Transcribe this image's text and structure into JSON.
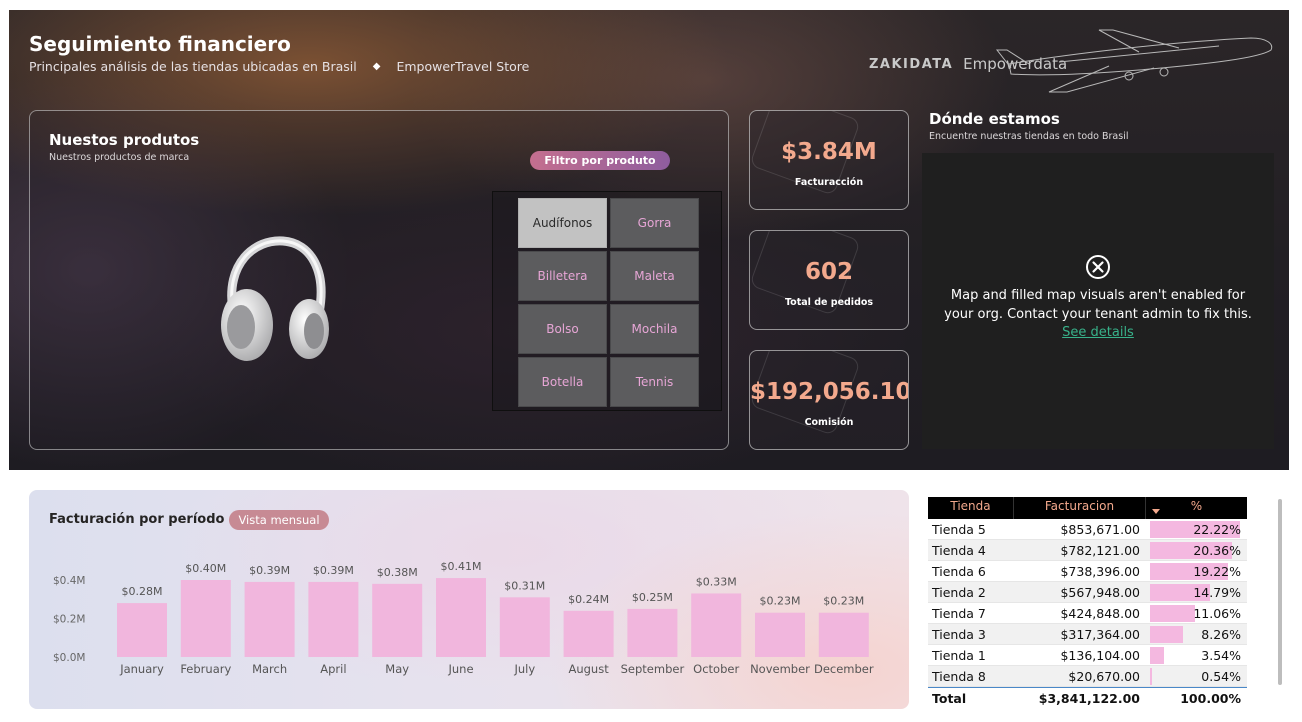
{
  "header": {
    "title": "Seguimiento financiero",
    "subtitle": "Principales análisis de las tiendas ubicadas en Brasil",
    "store_name": "EmpowerTravel Store",
    "brand_zakidata": "ZAKIDATA",
    "brand_empowerdata": "Empowerdata"
  },
  "products": {
    "title": "Nuestos produtos",
    "subtitle": "Nuestros productos de marca",
    "filter_label": "Filtro por produto",
    "buttons": [
      {
        "label": "Audífonos",
        "selected": true
      },
      {
        "label": "Gorra",
        "selected": false
      },
      {
        "label": "Billetera",
        "selected": false
      },
      {
        "label": "Maleta",
        "selected": false
      },
      {
        "label": "Bolso",
        "selected": false
      },
      {
        "label": "Mochila",
        "selected": false
      },
      {
        "label": "Botella",
        "selected": false
      },
      {
        "label": "Tennis",
        "selected": false
      }
    ]
  },
  "kpis": [
    {
      "value": "$3.84M",
      "label": "Facturacción"
    },
    {
      "value": "602",
      "label": "Total de pedidos"
    },
    {
      "value": "$192,056.10",
      "label": "Comisión"
    }
  ],
  "map": {
    "title": "Dónde estamos",
    "subtitle": "Encuentre nuestras tiendas en todo Brasil",
    "message": "Map and filled map visuals aren't enabled for your org. Contact your tenant admin to fix this.",
    "link": "See details"
  },
  "chart_title": "Facturación por período",
  "chart_toggle": "Vista mensual",
  "chart_data": {
    "type": "bar",
    "categories": [
      "January",
      "February",
      "March",
      "April",
      "May",
      "June",
      "July",
      "August",
      "September",
      "October",
      "November",
      "December"
    ],
    "values": [
      0.28,
      0.4,
      0.39,
      0.39,
      0.38,
      0.41,
      0.31,
      0.24,
      0.25,
      0.33,
      0.23,
      0.23
    ],
    "data_labels": [
      "$0.28M",
      "$0.40M",
      "$0.39M",
      "$0.39M",
      "$0.38M",
      "$0.41M",
      "$0.31M",
      "$0.24M",
      "$0.25M",
      "$0.33M",
      "$0.23M",
      "$0.23M"
    ],
    "yticks": [
      0,
      0.2,
      0.4
    ],
    "ytick_labels": [
      "$0.0M",
      "$0.2M",
      "$0.4M"
    ],
    "ylim": [
      0,
      0.42
    ],
    "title": "Facturación por período",
    "bar_color": "#f1b6dd"
  },
  "table": {
    "columns": [
      "Tienda",
      "Facturacion",
      "%"
    ],
    "rows": [
      {
        "tienda": "Tienda 5",
        "facturacion": "$853,671.00",
        "pct_label": "22.22%",
        "pct": 22.22
      },
      {
        "tienda": "Tienda 4",
        "facturacion": "$782,121.00",
        "pct_label": "20.36%",
        "pct": 20.36
      },
      {
        "tienda": "Tienda 6",
        "facturacion": "$738,396.00",
        "pct_label": "19.22%",
        "pct": 19.22
      },
      {
        "tienda": "Tienda 2",
        "facturacion": "$567,948.00",
        "pct_label": "14.79%",
        "pct": 14.79
      },
      {
        "tienda": "Tienda 7",
        "facturacion": "$424,848.00",
        "pct_label": "11.06%",
        "pct": 11.06
      },
      {
        "tienda": "Tienda 3",
        "facturacion": "$317,364.00",
        "pct_label": "8.26%",
        "pct": 8.26
      },
      {
        "tienda": "Tienda 1",
        "facturacion": "$136,104.00",
        "pct_label": "3.54%",
        "pct": 3.54
      },
      {
        "tienda": "Tienda 8",
        "facturacion": "$20,670.00",
        "pct_label": "0.54%",
        "pct": 0.54
      }
    ],
    "total": {
      "label": "Total",
      "facturacion": "$3,841,122.00",
      "pct_label": "100.00%"
    }
  },
  "colors": {
    "accent_salmon": "#f3a98d",
    "accent_pink": "#e7a6d6",
    "bar_pink": "#f1b6dd",
    "link_green": "#38b28a"
  }
}
